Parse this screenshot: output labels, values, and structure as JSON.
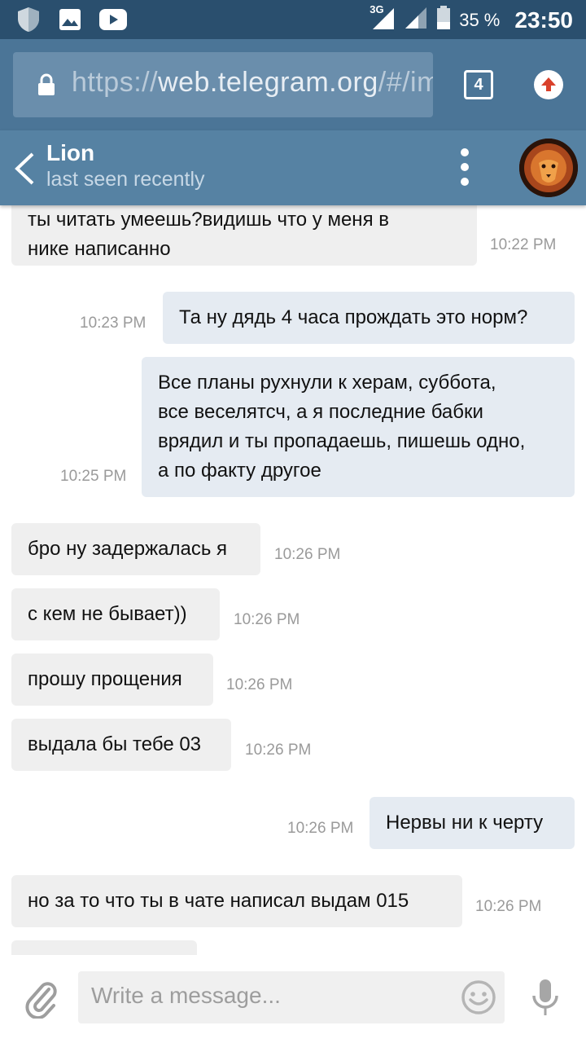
{
  "status_bar": {
    "network": "3G",
    "battery": "35 %",
    "time": "23:50",
    "left_icons": [
      "shield-icon",
      "gallery-icon",
      "youtube-icon"
    ]
  },
  "browser": {
    "url_scheme": "https://",
    "url_host": "web.telegram.org",
    "url_rest": "/#/im",
    "tab_count": "4"
  },
  "chat": {
    "name": "Lion",
    "status": "last seen recently"
  },
  "messages": [
    {
      "dir": "in",
      "lines": [
        "ты читать умеешь?видишь что у меня в",
        "нике написанно"
      ],
      "time": "10:22 PM"
    },
    {
      "dir": "out",
      "lines": [
        "Та ну дядь 4 часа прождать это норм?"
      ],
      "time": "10:23 PM"
    },
    {
      "dir": "out",
      "lines": [
        "Все планы рухнули к херам, суббота,",
        "все веселятсч, а я последние бабки",
        "врядил и ты пропадаешь, пишешь одно,",
        "а по факту другое"
      ],
      "time": "10:25 PM"
    },
    {
      "dir": "in",
      "lines": [
        "бро ну задержалась я"
      ],
      "time": "10:26 PM"
    },
    {
      "dir": "in",
      "lines": [
        "с кем не бывает))"
      ],
      "time": "10:26 PM"
    },
    {
      "dir": "in",
      "lines": [
        "прошу прощения"
      ],
      "time": "10:26 PM"
    },
    {
      "dir": "in",
      "lines": [
        "выдала бы тебе 03"
      ],
      "time": "10:26 PM"
    },
    {
      "dir": "out",
      "lines": [
        "Нервы ни к черту"
      ],
      "time": "10:26 PM"
    },
    {
      "dir": "in",
      "lines": [
        "но за то что ты в чате написал выдам 015"
      ],
      "time": "10:26 PM"
    }
  ],
  "composer": {
    "placeholder": "Write a message..."
  },
  "colors": {
    "status_bar": "#2a4f6e",
    "browser_bar": "#4b7597",
    "chat_header": "#5682a3",
    "bubble_in": "#efefef",
    "bubble_out": "#e5ebf2"
  }
}
